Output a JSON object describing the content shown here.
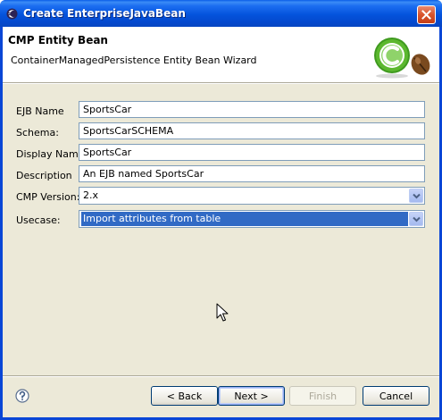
{
  "window": {
    "title": "Create EnterpriseJavaBean"
  },
  "header": {
    "title": "CMP Entity Bean",
    "subtitle": "ContainerManagedPersistence Entity Bean Wizard"
  },
  "form": {
    "ejb_name": {
      "label": "EJB Name",
      "value": "SportsCar"
    },
    "schema": {
      "label": "Schema:",
      "value": "SportsCarSCHEMA"
    },
    "display_name": {
      "label": "Display Name",
      "value": "SportsCar"
    },
    "description": {
      "label": "Description",
      "value": "An EJB named SportsCar"
    },
    "cmp_version": {
      "label": "CMP Version:",
      "value": "2.x"
    },
    "usecase": {
      "label": "Usecase:",
      "value": "Import attributes from table"
    }
  },
  "buttons": {
    "back": "< Back",
    "next": "Next >",
    "finish": "Finish",
    "cancel": "Cancel"
  },
  "icons": {
    "title": "eclipse-icon",
    "logo": "cmp-bean-logo-icon",
    "help": "help-icon",
    "close": "close-icon",
    "pointer": "mouse-cursor-icon"
  },
  "colors": {
    "title_bar": "#0a46d6",
    "selection": "#316ac5",
    "logo_green": "#5cb82f",
    "dialog_bg": "#ece9d8"
  }
}
